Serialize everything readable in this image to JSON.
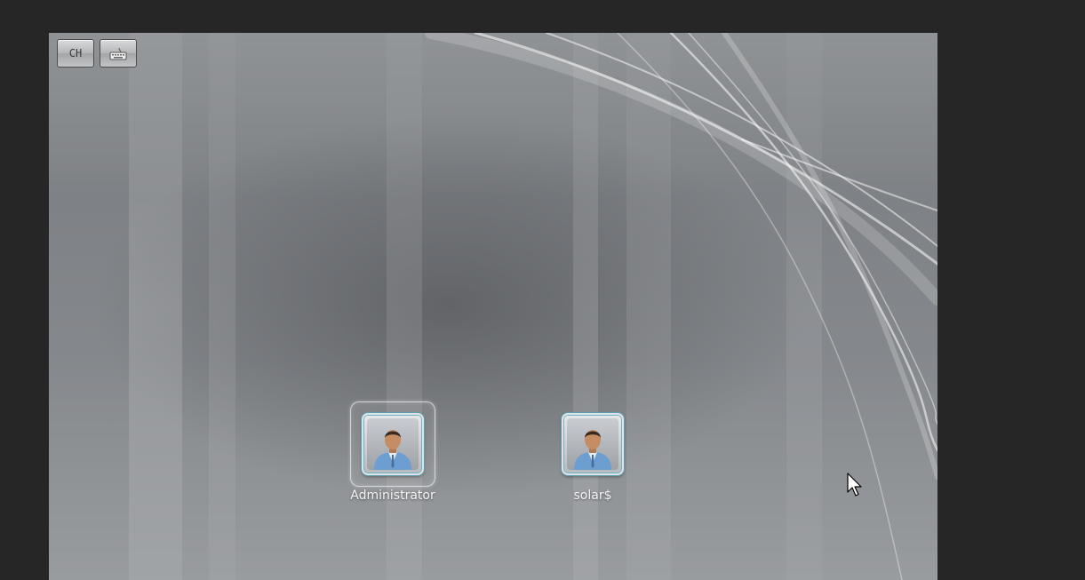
{
  "toolbar": {
    "language_label": "CH",
    "keyboard_icon": "keyboard-icon"
  },
  "users": [
    {
      "name": "Administrator",
      "selected": true,
      "icon": "user-avatar-icon"
    },
    {
      "name": "solar$",
      "selected": false,
      "icon": "user-avatar-icon"
    }
  ],
  "cursor_icon": "mouse-pointer-icon",
  "colors": {
    "outer_background": "#262626",
    "accent_teal": "#5f9fb0",
    "label_text": "#f4f5f6"
  }
}
